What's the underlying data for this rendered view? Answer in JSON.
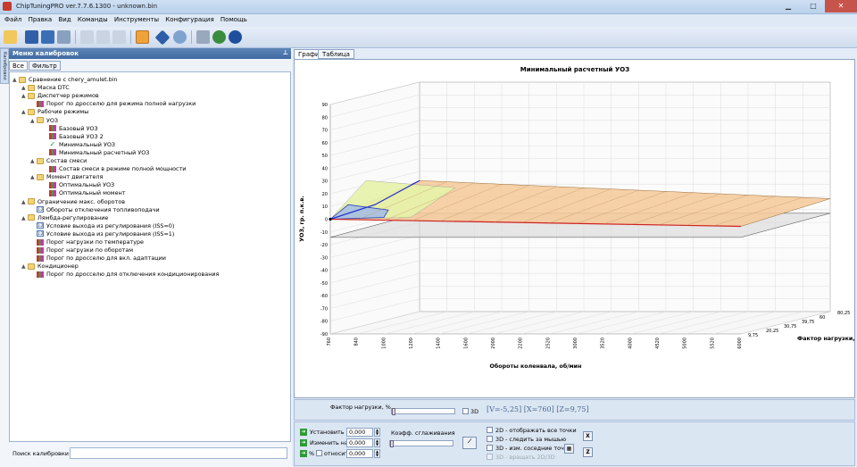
{
  "window": {
    "title": "ChipTuningPRO ver.7.7.6.1300 - unknown.bin",
    "minimize_icon": "minimize-icon",
    "maximize_icon": "maximize-icon",
    "close_icon": "close-icon"
  },
  "menu": [
    "Файл",
    "Правка",
    "Вид",
    "Команды",
    "Инструменты",
    "Конфигурация",
    "Помощь"
  ],
  "left": {
    "side_tab": "Калибровки",
    "header": "Меню калибровок",
    "tabs": [
      "Все",
      "Фильтр"
    ],
    "tree": [
      {
        "label": "Сравнение с chery_amulet.bin",
        "level": 0,
        "icon": "folder"
      },
      {
        "label": "Маска DTC",
        "level": 1,
        "icon": "folder"
      },
      {
        "label": "Диспетчер режимов",
        "level": 1,
        "icon": "folder"
      },
      {
        "label": "Порог по дросселю для режима полной нагрузки",
        "level": 2,
        "icon": "map"
      },
      {
        "label": "Рабочие режимы",
        "level": 1,
        "icon": "folder"
      },
      {
        "label": "УОЗ",
        "level": 2,
        "icon": "folder"
      },
      {
        "label": "Базовый УОЗ",
        "level": 3,
        "icon": "map"
      },
      {
        "label": "Базовый УОЗ 2",
        "level": 3,
        "icon": "map"
      },
      {
        "label": "Минимальный УОЗ",
        "level": 3,
        "icon": "check"
      },
      {
        "label": "Минимальный расчетный УОЗ",
        "level": 3,
        "icon": "map"
      },
      {
        "label": "Состав смеси",
        "level": 2,
        "icon": "folder"
      },
      {
        "label": "Состав смеси в режиме полной мощности",
        "level": 3,
        "icon": "map"
      },
      {
        "label": "Момент двигателя",
        "level": 2,
        "icon": "folder"
      },
      {
        "label": "Оптимальный УОЗ",
        "level": 3,
        "icon": "map"
      },
      {
        "label": "Оптимальный момент",
        "level": 3,
        "icon": "map"
      },
      {
        "label": "Ограничение макс. оборотов",
        "level": 1,
        "icon": "folder"
      },
      {
        "label": "Обороты отключения топливоподачи",
        "level": 2,
        "icon": "val"
      },
      {
        "label": "Лямбда-регулирование",
        "level": 1,
        "icon": "folder"
      },
      {
        "label": "Условие выхода из регулирования (ISS=0)",
        "level": 2,
        "icon": "val"
      },
      {
        "label": "Условие выхода из регулирования (ISS=1)",
        "level": 2,
        "icon": "val"
      },
      {
        "label": "Порог нагрузки по температуре",
        "level": 2,
        "icon": "map"
      },
      {
        "label": "Порог нагрузки по оборотам",
        "level": 2,
        "icon": "map"
      },
      {
        "label": "Порог по дросселю для вкл. адаптации",
        "level": 2,
        "icon": "map"
      },
      {
        "label": "Кондиционер",
        "level": 1,
        "icon": "folder"
      },
      {
        "label": "Порог по дросселю для отключения кондиционирования",
        "level": 2,
        "icon": "map"
      }
    ],
    "search_label": "Поиск калибровки"
  },
  "right": {
    "tabs": [
      "График",
      "Таблица"
    ],
    "controls": {
      "load_factor_label": "Фактор нагрузки, %",
      "checkbox_3d": "3D",
      "coords": "[V=-5,25] [X=760] [Z=9,75]",
      "set_label": "Установить в",
      "set_value": "0,000",
      "change_label": "Изменить на",
      "change_value": "0,000",
      "percent_label": "%",
      "relative_label": "относит.",
      "relative_value": "0,000",
      "smoothing_label": "Коэфф. сглаживания",
      "options": [
        "2D - отображать все точки",
        "3D - следить за мышью",
        "3D - изм. соседние точки",
        "3D - вращать 2D/3D"
      ],
      "btn_x": "X",
      "btn_z": "Z"
    }
  },
  "chart_data": {
    "type": "3d-surface",
    "title": "Минимальный расчетный УОЗ",
    "xlabel": "Обороты коленвала, об/мин",
    "ylabel": "УОЗ, гр. п.к.в.",
    "zlabel": "Фактор нагрузки, %",
    "x_ticks": [
      "760",
      "840",
      "1000",
      "1200",
      "1400",
      "1600",
      "2000",
      "2200",
      "2520",
      "3000",
      "3520",
      "4000",
      "4520",
      "5000",
      "5520",
      "6000"
    ],
    "y_ticks": [
      90,
      80,
      70,
      60,
      50,
      40,
      30,
      20,
      10,
      0,
      -10,
      -20,
      -30,
      -40,
      -50,
      -60,
      -70,
      -80,
      -90
    ],
    "ylim": [
      -90,
      90
    ],
    "z_ticks": [
      "9,75",
      "20,25",
      "30,75",
      "39,75",
      "60",
      "80,25"
    ]
  }
}
